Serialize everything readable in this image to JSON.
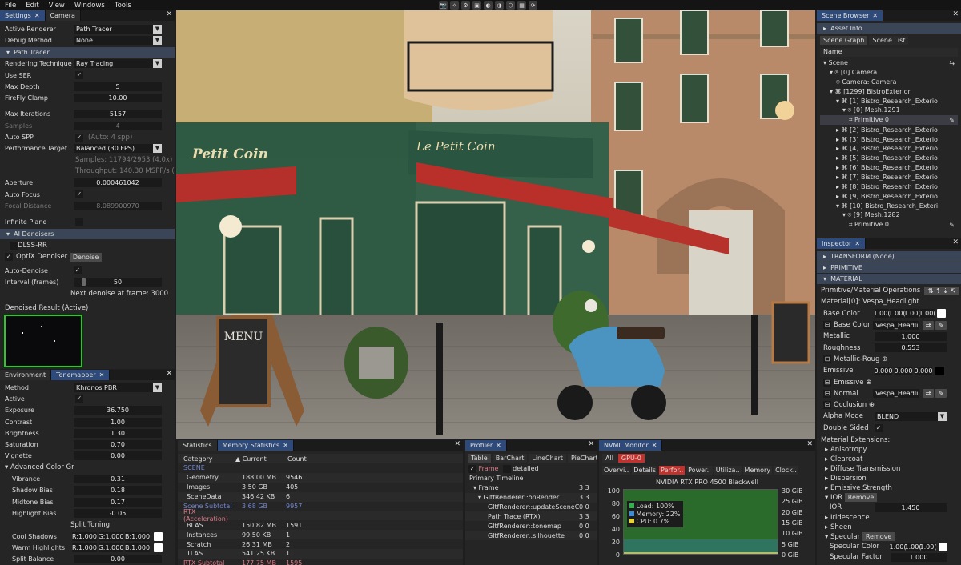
{
  "menu": [
    "File",
    "Edit",
    "View",
    "Windows",
    "Tools"
  ],
  "toolbar_icons": [
    "📷",
    "✧",
    "⚙",
    "▣",
    "◐",
    "◑",
    "⬡",
    "▦",
    "⟳"
  ],
  "settings": {
    "tabs": [
      "Settings",
      "Camera"
    ],
    "rows": [
      {
        "label": "Active Renderer",
        "value": "Path Tracer",
        "type": "dd"
      },
      {
        "label": "Debug Method",
        "value": "None",
        "type": "dd"
      }
    ],
    "pt_header": "Path Tracer",
    "pt_rows": [
      {
        "label": "Rendering Technique",
        "value": "Ray Tracing",
        "type": "dd"
      },
      {
        "label": "Use SER",
        "value": "✓",
        "type": "chk"
      },
      {
        "label": "Max Depth",
        "value": "5",
        "type": "num"
      },
      {
        "label": "FireFly Clamp",
        "value": "10.00",
        "type": "num"
      },
      {
        "label": "",
        "value": "",
        "type": "sp"
      },
      {
        "label": "Max Iterations",
        "value": "5157",
        "type": "num"
      },
      {
        "label": "Samples",
        "value": "4",
        "type": "numdim"
      },
      {
        "label": "Auto SPP",
        "value": "(Auto: 4 spp)",
        "type": "chktext"
      },
      {
        "label": "Performance Target",
        "value": "Balanced (30 FPS)",
        "type": "dd"
      },
      {
        "label": "",
        "value": "Samples: 11794/2953 (4.0x)",
        "type": "info"
      },
      {
        "label": "",
        "value": "Throughput: 140.30 MSPP/s   (1",
        "type": "info"
      },
      {
        "label": "Aperture",
        "value": "0.000461042",
        "type": "num"
      },
      {
        "label": "Auto Focus",
        "value": "✓",
        "type": "chk"
      },
      {
        "label": "Focal Distance",
        "value": "8.089900970",
        "type": "numdim"
      },
      {
        "label": "",
        "value": "",
        "type": "sp"
      },
      {
        "label": "Infinite Plane",
        "value": "",
        "type": "chk"
      }
    ],
    "ai_header": "AI Denoisers",
    "dlss": "DLSS-RR",
    "optix": "OptiX Denoiser",
    "denoise_btn": "Denoise",
    "auto_denoise": "Auto-Denoise",
    "interval_label": "Interval (frames)",
    "interval_value": "50",
    "next_denoise": "Next denoise at frame: 3000",
    "denoised_label": "Denoised Result (Active)"
  },
  "env": {
    "tabs": [
      "Environment",
      "Tonemapper"
    ],
    "rows": [
      {
        "label": "Method",
        "value": "Khronos PBR",
        "type": "dd"
      },
      {
        "label": "Active",
        "value": "✓",
        "type": "chk"
      },
      {
        "label": "Exposure",
        "value": "36.750",
        "type": "num"
      },
      {
        "label": "Contrast",
        "value": "1.00",
        "type": "num"
      },
      {
        "label": "Brightness",
        "value": "1.30",
        "type": "num"
      },
      {
        "label": "Saturation",
        "value": "0.70",
        "type": "num"
      },
      {
        "label": "Vignette",
        "value": "0.00",
        "type": "num"
      }
    ],
    "adv": "Advanced Color Gr",
    "adv_rows": [
      {
        "label": "Vibrance",
        "value": "0.31"
      },
      {
        "label": "Shadow Bias",
        "value": "0.18"
      },
      {
        "label": "Midtone Bias",
        "value": "0.17"
      },
      {
        "label": "Highlight Bias",
        "value": "-0.05"
      }
    ],
    "split": "Split Toning",
    "cool": "Cool Shadows",
    "warm": "Warm Highlights",
    "rgb": [
      "R:1.000",
      "G:1.000",
      "B:1.000"
    ],
    "split_balance": "Split Balance",
    "split_val": "0.00"
  },
  "viewport": {
    "sign1": "Petit Coin",
    "sign2": "Le Petit Coin",
    "menu": "MENU"
  },
  "stats": {
    "tabs": [
      "Statistics",
      "Memory Statistics"
    ],
    "cols": [
      "Category",
      "Current",
      "Count"
    ],
    "rows": [
      {
        "c": "SCENE",
        "v": "",
        "n": "",
        "cls": "sec"
      },
      {
        "c": "Geometry",
        "v": "188.00 MB",
        "n": "9546"
      },
      {
        "c": "Images",
        "v": "3.50 GB",
        "n": "405"
      },
      {
        "c": "SceneData",
        "v": "346.42 KB",
        "n": "6"
      },
      {
        "c": "Scene Subtotal",
        "v": "3.68 GB",
        "n": "9957",
        "cls": "sec"
      },
      {
        "c": "RTX (Acceleration)",
        "v": "",
        "n": "",
        "cls": "red"
      },
      {
        "c": "BLAS",
        "v": "150.82 MB",
        "n": "1591"
      },
      {
        "c": "Instances",
        "v": "99.50 KB",
        "n": "1"
      },
      {
        "c": "Scratch",
        "v": "26.31 MB",
        "n": "2"
      },
      {
        "c": "TLAS",
        "v": "541.25 KB",
        "n": "1"
      },
      {
        "c": "RTX Subtotal",
        "v": "177.75 MB",
        "n": "1595",
        "cls": "red"
      }
    ]
  },
  "profiler": {
    "tab": "Profiler",
    "subtabs": [
      "Table",
      "BarChart",
      "LineChart",
      "PieChart"
    ],
    "filter_label": "Frame",
    "detailed": "detailed",
    "timeline": "Primary Timeline",
    "rows": [
      {
        "t": "▾ Frame",
        "v": "3 3"
      },
      {
        "t": "▾ GltfRenderer::onRender",
        "v": "3 3"
      },
      {
        "t": "GltfRenderer::updateSceneCh",
        "v": "0 0"
      },
      {
        "t": "Path Trace (RTX)",
        "v": "3 3"
      },
      {
        "t": "GltfRenderer::tonemap",
        "v": "0 0"
      },
      {
        "t": "GltfRenderer::silhouette",
        "v": "0 0"
      }
    ]
  },
  "nvml": {
    "tab": "NVML Monitor",
    "gpu_tabs": [
      "All",
      "GPU-0"
    ],
    "subtabs": [
      "Overvi..",
      "Details",
      "Perfor..",
      "Power..",
      "Utiliza..",
      "Memory",
      "Clock.."
    ],
    "gpu_name": "NVIDIA RTX PRO 4500 Blackwell",
    "yaxis": [
      "100",
      "80",
      "60",
      "40",
      "20",
      "0"
    ],
    "raxis": [
      "30 GiB",
      "25 GiB",
      "20 GiB",
      "15 GiB",
      "10 GiB",
      "5 GiB",
      "0 GiB"
    ],
    "legend": [
      "Load: 100%",
      "Memory: 22%",
      "CPU: 0.7%"
    ],
    "colors": {
      "load": "#2fb14d",
      "memory": "#3a8cd8",
      "cpu": "#e8d33a"
    }
  },
  "scene": {
    "tab": "Scene Browser",
    "asset": "Asset Info",
    "subtabs": [
      "Scene Graph",
      "Scene List"
    ],
    "name_col": "Name",
    "items": [
      {
        "d": 0,
        "t": "▾ Scene"
      },
      {
        "d": 1,
        "t": "▾ ⌾ [0] Camera"
      },
      {
        "d": 2,
        "t": "⌾ Camera: Camera"
      },
      {
        "d": 1,
        "t": "▾ ⌘ [1299] BistroExterior"
      },
      {
        "d": 2,
        "t": "▾ ⌘ [1] Bistro_Research_Exterio"
      },
      {
        "d": 3,
        "t": "▾ ⌾ [0] Mesh.1291"
      },
      {
        "d": 4,
        "t": "⌗ Primitive 0",
        "sel": true
      },
      {
        "d": 2,
        "t": "▸ ⌘ [2] Bistro_Research_Exterio"
      },
      {
        "d": 2,
        "t": "▸ ⌘ [3] Bistro_Research_Exterio"
      },
      {
        "d": 2,
        "t": "▸ ⌘ [4] Bistro_Research_Exterio"
      },
      {
        "d": 2,
        "t": "▸ ⌘ [5] Bistro_Research_Exterio"
      },
      {
        "d": 2,
        "t": "▸ ⌘ [6] Bistro_Research_Exterio"
      },
      {
        "d": 2,
        "t": "▸ ⌘ [7] Bistro_Research_Exterio"
      },
      {
        "d": 2,
        "t": "▸ ⌘ [8] Bistro_Research_Exterio"
      },
      {
        "d": 2,
        "t": "▸ ⌘ [9] Bistro_Research_Exterio"
      },
      {
        "d": 2,
        "t": "▾ ⌘ [10] Bistro_Research_Exteri"
      },
      {
        "d": 3,
        "t": "▾ ⌾ [9] Mesh.1282"
      },
      {
        "d": 4,
        "t": "⌗ Primitive 0"
      }
    ]
  },
  "inspector": {
    "tab": "Inspector",
    "sections": [
      "TRANSFORM (Node)",
      "PRIMITIVE",
      "MATERIAL"
    ],
    "ops": "Primitive/Material Operations",
    "material": "Material[0]: Vespa_Headlight",
    "base_color": "Base Color",
    "base_vals": [
      "1.00(",
      "1.00(",
      "1.00(",
      "1.00("
    ],
    "base_tex": "Base Color",
    "base_tex_val": "Vespa_Headli",
    "metallic": "Metallic",
    "metallic_val": "1.000",
    "rough": "Roughness",
    "rough_val": "0.553",
    "metrough": "Metallic-Roug",
    "emissive": "Emissive",
    "emissive_vals": [
      "0.000",
      "0.000",
      "0.000"
    ],
    "emissive_tex": "Emissive",
    "normal": "Normal",
    "normal_val": "Vespa_Headli",
    "occlusion": "Occlusion",
    "alpha": "Alpha Mode",
    "alpha_val": "BLEND",
    "double": "Double Sided",
    "ext": "Material Extensions:",
    "exts": [
      "Anisotropy",
      "Clearcoat",
      "Diffuse Transmission",
      "Dispersion",
      "Emissive Strength"
    ],
    "ior": "IOR",
    "remove": "Remove",
    "ior_label": "IOR",
    "ior_val": "1.450",
    "exts2": [
      "Iridescence",
      "Sheen"
    ],
    "specular": "Specular",
    "spec_color": "Specular Color",
    "spec_vals": [
      "1.00(",
      "1.00(",
      "1.00("
    ],
    "spec_factor": "Specular Factor",
    "spec_factor_val": "1.000"
  }
}
